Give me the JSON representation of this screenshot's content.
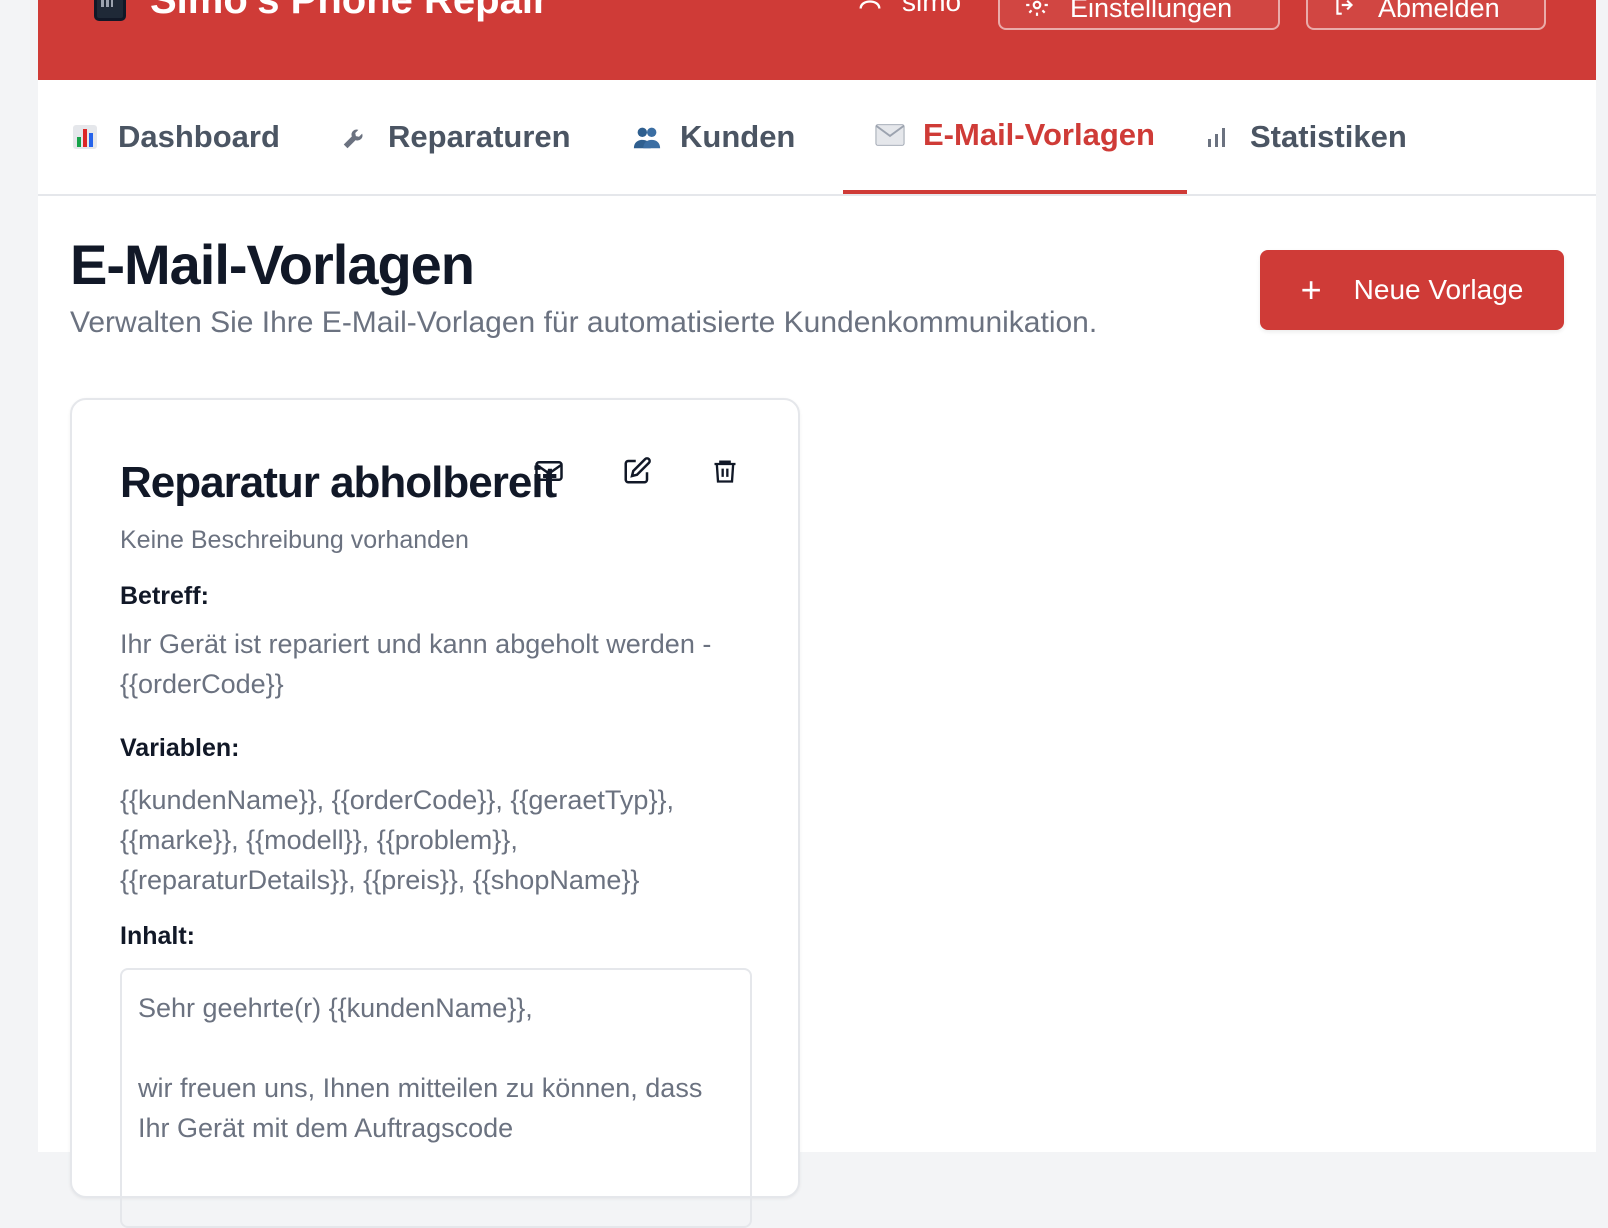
{
  "header": {
    "app_title": "Simo's Phone Repair",
    "user_name": "simo",
    "settings_label": "Einstellungen",
    "logout_label": "Abmelden"
  },
  "nav": {
    "tabs": [
      {
        "label": "Dashboard",
        "icon": "bar-chart-icon"
      },
      {
        "label": "Reparaturen",
        "icon": "wrench-icon"
      },
      {
        "label": "Kunden",
        "icon": "users-icon"
      },
      {
        "label": "E-Mail-Vorlagen",
        "icon": "envelope-icon",
        "active": true
      },
      {
        "label": "Statistiken",
        "icon": "signal-bars-icon"
      }
    ]
  },
  "page": {
    "title": "E-Mail-Vorlagen",
    "subtitle": "Verwalten Sie Ihre E-Mail-Vorlagen für automatisierte Kundenkommunikation.",
    "new_button_label": "Neue Vorlage"
  },
  "template_card": {
    "title": "Reparatur abholbereit",
    "description": "Keine Beschreibung vorhanden",
    "subject_label": "Betreff:",
    "subject_value": "Ihr Gerät ist repariert und kann abgeholt werden - {{orderCode}}",
    "variables_label": "Variablen:",
    "variables_value": "{{kundenName}}, {{orderCode}}, {{geraetTyp}}, {{marke}}, {{modell}}, {{problem}}, {{reparaturDetails}}, {{preis}}, {{shopName}}",
    "content_label": "Inhalt:",
    "content_value": "Sehr geehrte(r) {{kundenName}},\n\nwir freuen uns, Ihnen mitteilen zu können, dass Ihr Gerät mit dem Auftragscode"
  },
  "colors": {
    "brand": "#cf3b37",
    "text_muted": "#6b7280",
    "text_dark": "#111827"
  }
}
